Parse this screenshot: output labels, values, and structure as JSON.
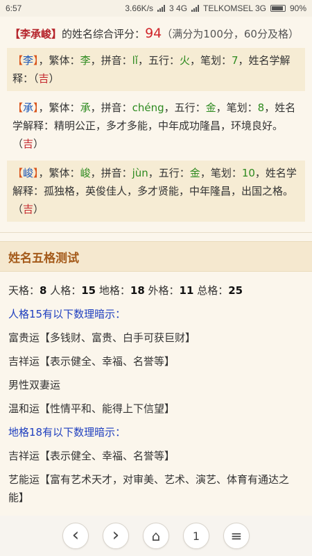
{
  "status": {
    "time": "6:57",
    "speed": "3.66K/s",
    "net1": "3 4G",
    "carrier": "TELKOMSEL 3G",
    "battery": "90%",
    "battery_level": 0.9
  },
  "score": {
    "open": "【",
    "name": "李承峻",
    "close": "】",
    "label": "的姓名综合评分：",
    "value": "94",
    "note": "（满分为100分，60分及格）"
  },
  "chars": [
    {
      "open": "【",
      "char": "李",
      "close": "】",
      "t_label": "，繁体：",
      "trad": "李",
      "p_label": "，拼音：",
      "pinyin": "lǐ",
      "w_label": "，五行：",
      "wuxing": "火",
      "s_label": "，笔划：",
      "strokes": "7",
      "e_label": "，姓名学解释：（",
      "explain": "",
      "luck": "吉",
      "end": "）"
    },
    {
      "open": "【",
      "char": "承",
      "close": "】",
      "t_label": "，繁体：",
      "trad": "承",
      "p_label": "，拼音：",
      "pinyin": "chéng",
      "w_label": "，五行：",
      "wuxing": "金",
      "s_label": "，笔划：",
      "strokes": "8",
      "e_label": "，姓名学解释：",
      "explain": "精明公正，多才多能，中年成功隆昌，环境良好。（",
      "luck": "吉",
      "end": "）"
    },
    {
      "open": "【",
      "char": "峻",
      "close": "】",
      "t_label": "，繁体：",
      "trad": "峻",
      "p_label": "，拼音：",
      "pinyin": "jùn",
      "w_label": "，五行：",
      "wuxing": "金",
      "s_label": "，笔划：",
      "strokes": "10",
      "e_label": "，姓名学解释：",
      "explain": "孤独格，英俊佳人，多才贤能，中年隆昌，出国之格。（",
      "luck": "吉",
      "end": "）"
    }
  ],
  "wuge": {
    "title": "姓名五格测试",
    "tian_label": "天格：",
    "tian": "8",
    "ren_label": " 人格：",
    "ren": "15",
    "di_label": " 地格：",
    "di": "18",
    "wai_label": " 外格：",
    "wai": "11",
    "zong_label": " 总格：",
    "zong": "25",
    "ren_hint": "人格15有以下数理暗示：",
    "ren_items": [
      "富贵运【多钱财、富贵、白手可获巨财】",
      "吉祥运【表示健全、幸福、名誉等】",
      "男性双妻运",
      "温和运【性情平和、能得上下信望】"
    ],
    "di_hint": "地格18有以下数理暗示：",
    "di_items": [
      "吉祥运【表示健全、幸福、名誉等】",
      "艺能运【富有艺术天才，对审美、艺术、演艺、体育有通达之能】"
    ]
  },
  "nav": {
    "back": "‹",
    "forward": "›",
    "home": "⌂",
    "tabs": "1",
    "menu": "≡"
  }
}
